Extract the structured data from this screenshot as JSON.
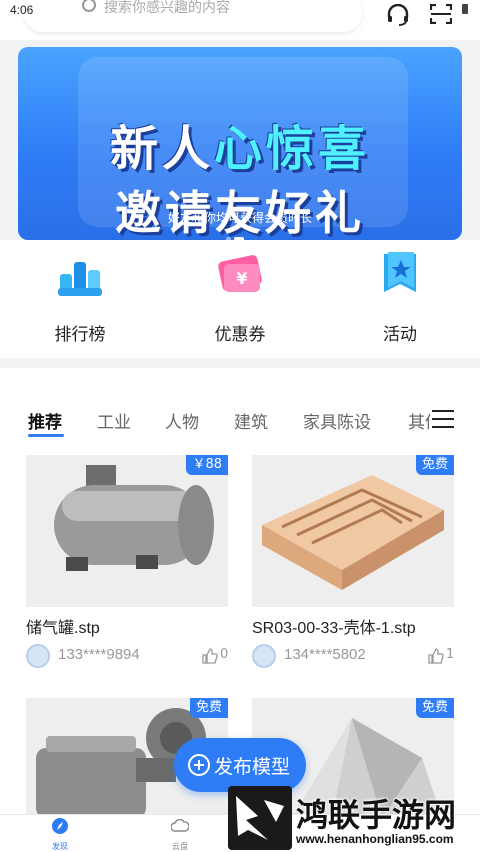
{
  "status": {
    "time": "4:06"
  },
  "search": {
    "placeholder": "搜索你感兴趣的内容"
  },
  "banner": {
    "line1_a": "新人",
    "line1_b": "心惊喜",
    "line2": "邀请友好礼",
    "caption": "好友和你均可获得会员时长"
  },
  "quick": [
    {
      "label": "排行榜",
      "icon": "ranking-icon"
    },
    {
      "label": "优惠券",
      "icon": "coupon-icon"
    },
    {
      "label": "活动",
      "icon": "activity-icon"
    }
  ],
  "categories": [
    "推荐",
    "工业",
    "人物",
    "建筑",
    "家具陈设",
    "其他"
  ],
  "cards": [
    {
      "title": "储气罐.stp",
      "badge": "￥88",
      "user": "133****9894",
      "likes": "0"
    },
    {
      "title": "SR03-00-33-壳体-1.stp",
      "badge": "免费",
      "user": "134****5802",
      "likes": "1"
    },
    {
      "title": "",
      "badge": "免费",
      "user": "",
      "likes": ""
    },
    {
      "title": "",
      "badge": "免费",
      "user": "",
      "likes": ""
    }
  ],
  "fab": {
    "label": "发布模型"
  },
  "tabs": [
    {
      "label": "发现"
    },
    {
      "label": "云盘"
    }
  ],
  "watermark": {
    "title": "鸿联手游网",
    "url": "www.henanhonglian95.com"
  },
  "colors": {
    "accent": "#2f7df6",
    "banner_top": "#4aa3ff",
    "highlight": "#4ff0ff"
  }
}
